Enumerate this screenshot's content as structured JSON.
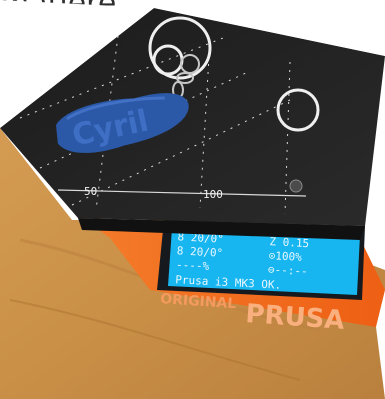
{
  "caption": "matière.",
  "bed": {
    "axis_labels": [
      "50",
      "100"
    ]
  },
  "keychain": {
    "text": "Cyril",
    "color": "#2b59a8"
  },
  "lcd": {
    "row1_left": "8 20/0°",
    "row1_right": "Z  0.15",
    "row2_left": "8 20/0°",
    "row2_right": "⊙100%",
    "row3_left": "----%",
    "row3_right": "⊖--:--",
    "status": "Prusa i3 MK3 OK.",
    "background": "#17b6f0"
  },
  "frame": {
    "logo_original": "ORIGINAL",
    "logo_prusa": "PRUSA",
    "color": "#f26a1b"
  }
}
